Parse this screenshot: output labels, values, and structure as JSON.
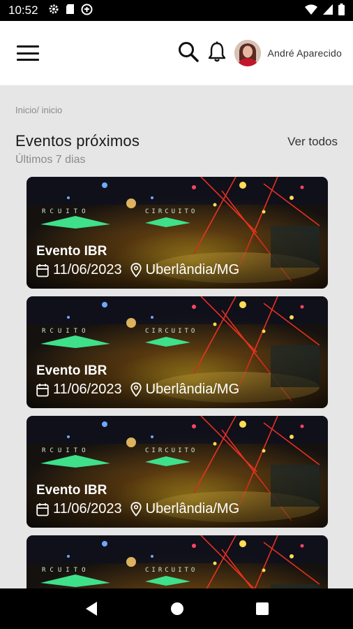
{
  "status": {
    "time": "10:52",
    "icons": [
      "gear-icon",
      "sd-card-icon",
      "data-saver-icon",
      "wifi-icon",
      "signal-icon",
      "battery-icon"
    ]
  },
  "appbar": {
    "user_name": "André Aparecido",
    "icons": [
      "menu-icon",
      "search-icon",
      "bell-icon",
      "avatar"
    ]
  },
  "breadcrumb": "Inicio/ inicio",
  "section": {
    "title": "Eventos próximos",
    "subtitle": "Últimos 7 dias",
    "see_all": "Ver todos"
  },
  "events": [
    {
      "title": "Evento IBR",
      "date": "11/06/2023",
      "location": "Uberlândia/MG"
    },
    {
      "title": "Evento IBR",
      "date": "11/06/2023",
      "location": "Uberlândia/MG"
    },
    {
      "title": "Evento IBR",
      "date": "11/06/2023",
      "location": "Uberlândia/MG"
    },
    {
      "title": "",
      "date": "",
      "location": ""
    }
  ],
  "navbar": {
    "icons": [
      "back-icon",
      "home-icon",
      "recents-icon"
    ]
  },
  "colors": {
    "background": "#e6e6e6",
    "appbar": "#ffffff",
    "stage_green": "#2ecc71",
    "stage_red": "#ff2a1a"
  }
}
